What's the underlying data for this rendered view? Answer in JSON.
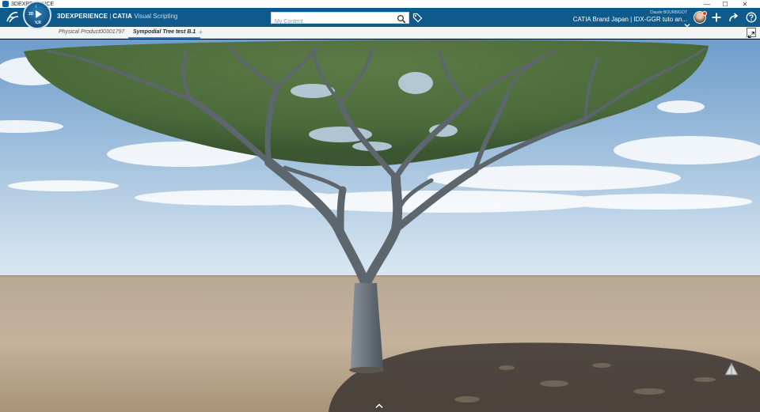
{
  "window": {
    "title": "3DEXPERIENCE",
    "minimize": "—",
    "maximize": "☐",
    "close": "✕"
  },
  "topbar": {
    "brand_3d": "3DEXPERIENCE",
    "separator": "|",
    "brand_catia": "CATIA",
    "app_name": "Visual Scripting",
    "compass": {
      "top": "i",
      "left": "3D",
      "bottom": "V,R"
    },
    "search": {
      "placeholder": "My Content",
      "value": ""
    },
    "user": {
      "name": "Claude BOURBIGOT",
      "context": "CATIA Brand Japan | IDX-GGR tuto an..."
    }
  },
  "tabs": [
    {
      "label": "Physical Product00301797",
      "active": false
    },
    {
      "label": "Sympodial Tree test B.1",
      "active": true
    }
  ],
  "tab_add": "+",
  "icons": {
    "ds_logo": "ds-logo-icon",
    "search": "search-icon",
    "tag": "tag-icon",
    "add": "plus-icon",
    "share": "share-icon",
    "help": "help-icon",
    "expand": "expand-icon",
    "compass_nav": "navigation-cone-icon",
    "bottom_toggle": "chevron-up-icon"
  },
  "colors": {
    "topbar": "#0e5a8a",
    "accent": "#2a8ad0",
    "sky_top": "#6e9dcc",
    "sky_bottom": "#dce8f2",
    "ground": "#b9a690",
    "foliage": "#4c6a3c",
    "trunk": "#6f7880"
  }
}
